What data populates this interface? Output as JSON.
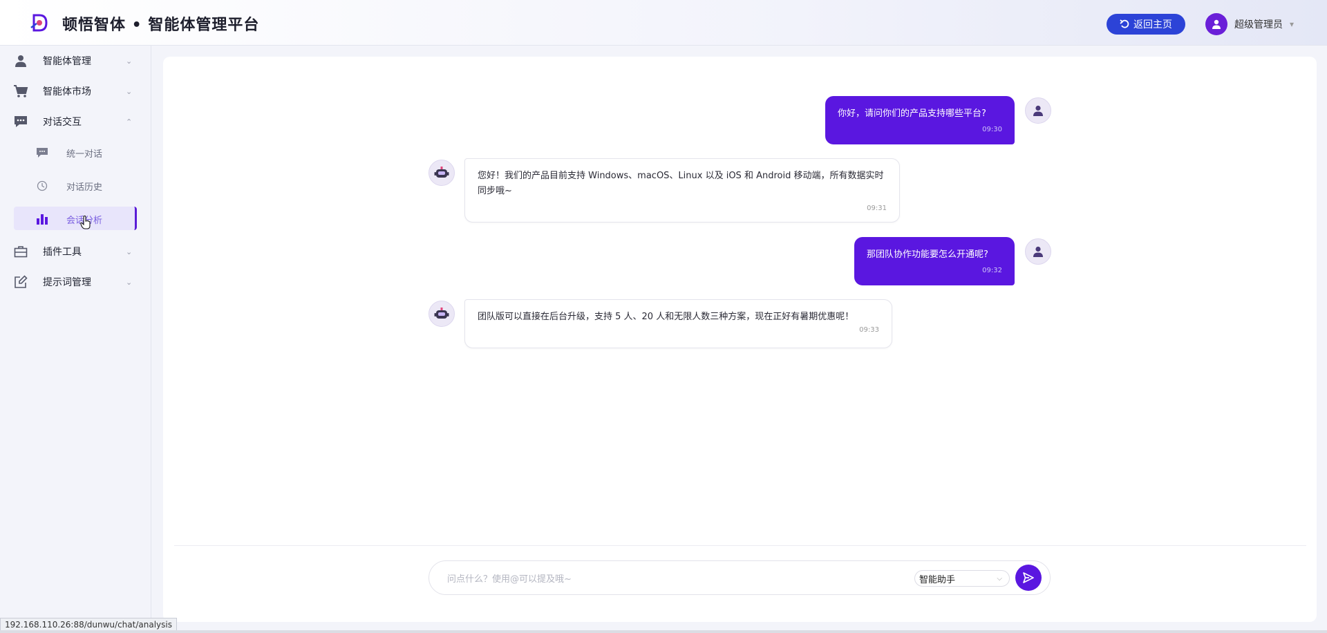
{
  "header": {
    "title": "顿悟智体 • 智能体管理平台",
    "home_button": "返回主页",
    "user_name": "超级管理员"
  },
  "sidebar": {
    "items": [
      {
        "label": "智能体管理",
        "icon": "user-icon",
        "expanded": false
      },
      {
        "label": "智能体市场",
        "icon": "cart-icon",
        "expanded": false
      },
      {
        "label": "对话交互",
        "icon": "chat-icon",
        "expanded": true
      },
      {
        "label": "插件工具",
        "icon": "toolbox-icon",
        "expanded": false
      },
      {
        "label": "提示词管理",
        "icon": "edit-icon",
        "expanded": false
      }
    ],
    "subitems": [
      {
        "label": "统一对话",
        "icon": "message-icon"
      },
      {
        "label": "对话历史",
        "icon": "clock-icon"
      },
      {
        "label": "会话分析",
        "icon": "bar-chart-icon",
        "active": true
      }
    ]
  },
  "chat": {
    "messages": [
      {
        "role": "user",
        "text": "你好，请问你们的产品支持哪些平台?",
        "time": "09:30"
      },
      {
        "role": "bot",
        "text": "您好！我们的产品目前支持 Windows、macOS、Linux 以及 iOS 和 Android 移动端，所有数据实时同步哦~",
        "time": "09:31"
      },
      {
        "role": "user",
        "text": "那团队协作功能要怎么开通呢?",
        "time": "09:32"
      },
      {
        "role": "bot",
        "text": "团队版可以直接在后台升级，支持 5 人、20 人和无限人数三种方案，现在正好有暑期优惠呢！",
        "time": "09:33"
      }
    ]
  },
  "composer": {
    "placeholder": "问点什么？使用@可以提及哦~",
    "agent_selected": "智能助手"
  },
  "status_bar": {
    "url": "192.168.110.26:88/dunwu/chat/analysis"
  },
  "colors": {
    "accent": "#5a17e0",
    "home_button": "#2c43d7"
  }
}
